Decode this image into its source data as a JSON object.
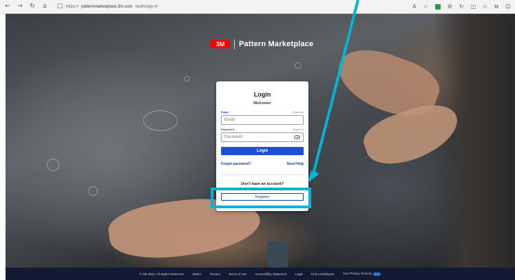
{
  "browser": {
    "url_prefix": "https://",
    "url_main": "patternmarketplace.3m.com",
    "url_path": "/auth/sign-in",
    "back_icon": "back-arrow-icon",
    "forward_icon": "forward-arrow-icon",
    "reload_icon": "reload-icon",
    "home_icon": "home-icon",
    "lock_icon": "lock-icon"
  },
  "brand": {
    "logo": "3M",
    "title": "Pattern Marketplace",
    "logo_color": "#ff0000"
  },
  "login": {
    "title": "Login",
    "welcome": "Welcome!",
    "email_label": "Email",
    "email_required": "Required",
    "email_placeholder": "Email",
    "password_label": "Password",
    "password_required": "Required",
    "password_placeholder": "Password",
    "login_button": "Login",
    "forgot_password": "Forgot password?",
    "need_help": "Need Help",
    "no_account": "Don't have an account?",
    "register_button": "Register",
    "primary_color": "#1f4ed6"
  },
  "annotation": {
    "color": "#00b4d8"
  },
  "footer": {
    "copyright": "© 3M 2023, All Rights Reserved.",
    "links": [
      "DMCA",
      "Privacy",
      "Terms of Use",
      "Accessibility Statement",
      "Legal",
      "Find a Distributor",
      "Your Privacy Choices"
    ],
    "background": "#121b33"
  }
}
